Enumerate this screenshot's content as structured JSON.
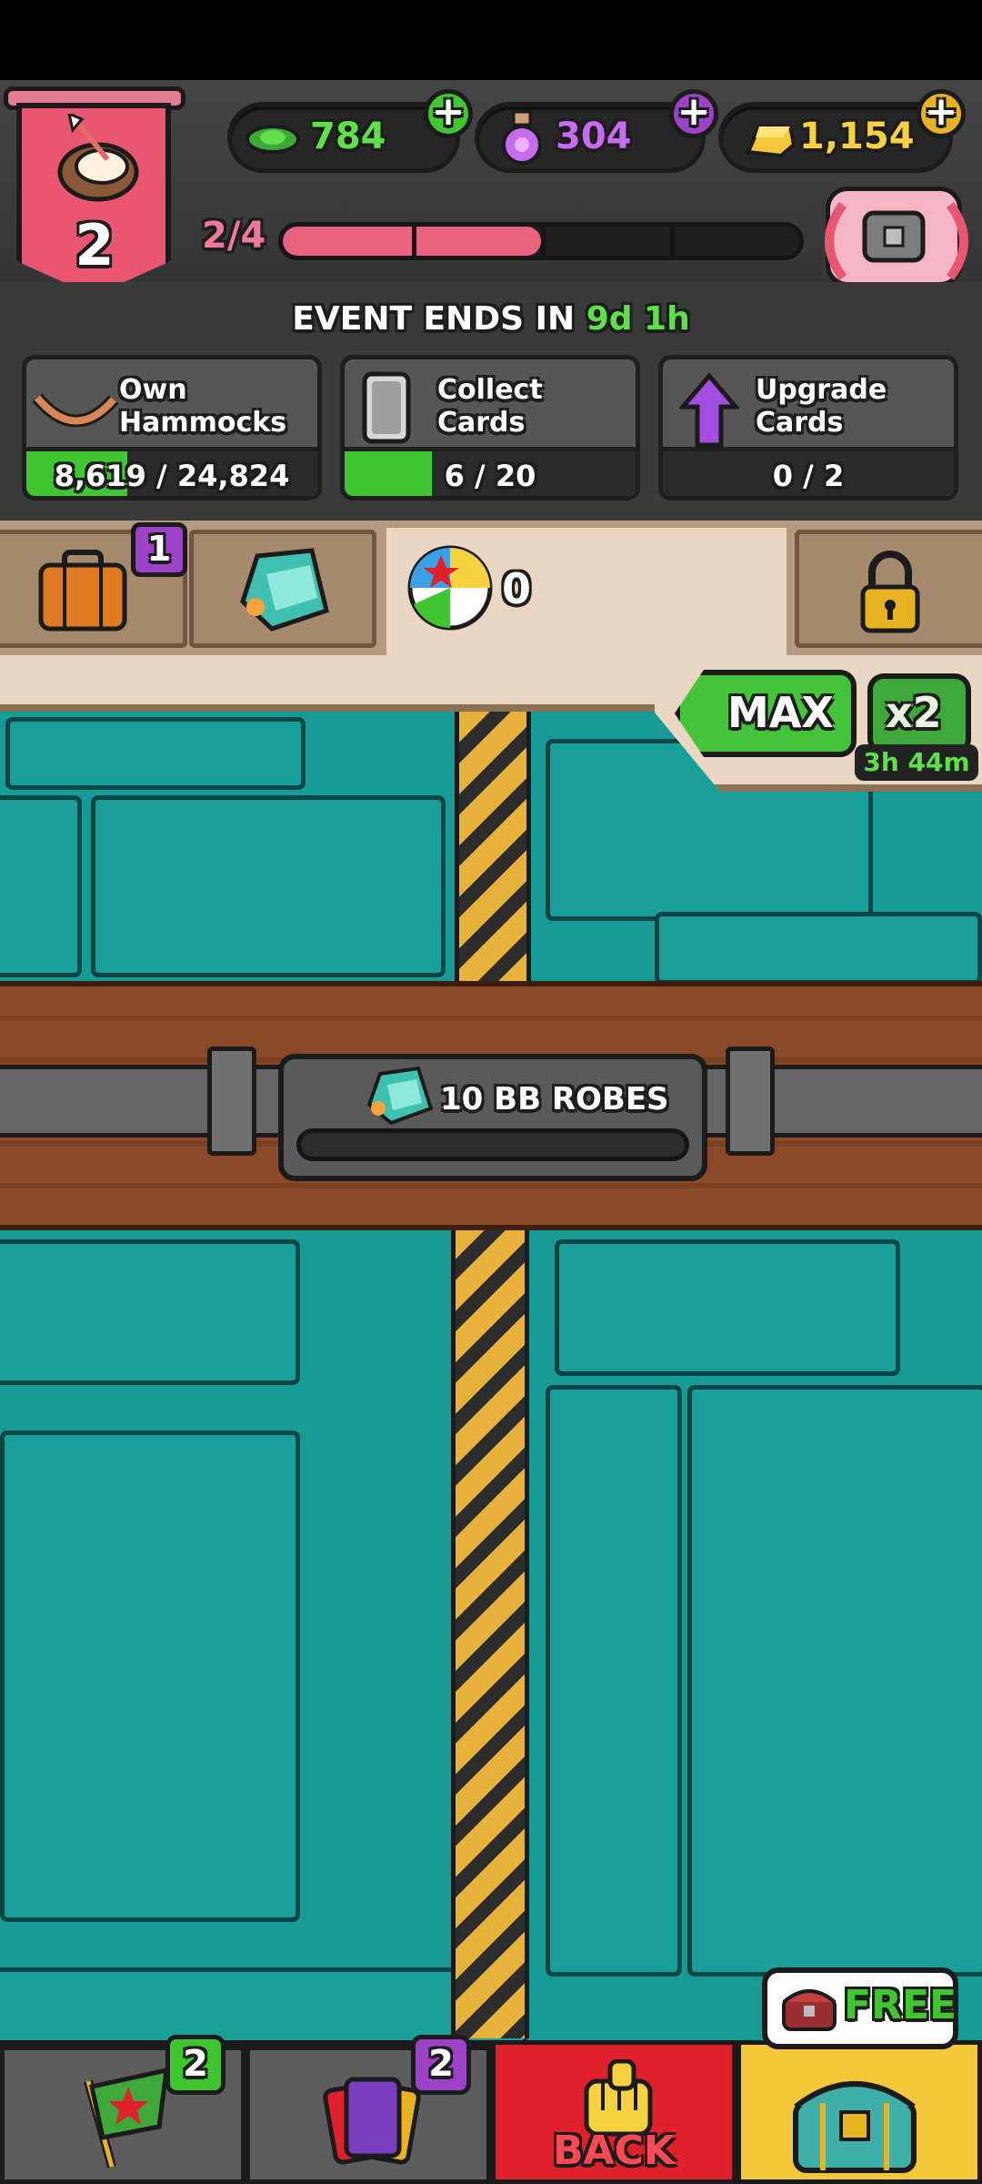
{
  "header": {
    "level": "2",
    "level_progress_text": "2/4",
    "level_progress_fraction": 0.5,
    "currencies": [
      {
        "name": "cash",
        "value": "784",
        "color": "#5fe04a",
        "plus_color": "#3fc630"
      },
      {
        "name": "potions",
        "value": "304",
        "color": "#c76bf0",
        "plus_color": "#9c42c7"
      },
      {
        "name": "gold",
        "value": "1,154",
        "color": "#f7d23f",
        "plus_color": "#e8b320"
      }
    ]
  },
  "event": {
    "timer_prefix": "EVENT ENDS IN",
    "timer_value": "9d 1h",
    "tasks": [
      {
        "label_line1": "Own",
        "label_line2": "Hammocks",
        "progress": "8,619 / 24,824",
        "fraction": 0.347
      },
      {
        "label_line1": "Collect Cards",
        "label_line2": "",
        "progress": "6 / 20",
        "fraction": 0.3
      },
      {
        "label_line1": "Upgrade",
        "label_line2": "Cards",
        "progress": "0 / 2",
        "fraction": 0.0
      }
    ]
  },
  "tabs": {
    "suitcase_badge": "1",
    "ball_count": "0"
  },
  "boost": {
    "max_label": "MAX",
    "x2_label": "x2",
    "x2_timer": "3h 44m"
  },
  "milestone": {
    "label": "10 BB ROBES",
    "fraction": 0.0
  },
  "bottom_nav": {
    "flag_badge": "2",
    "cards_badge": "2",
    "back_label": "BACK",
    "free_label": "FREE"
  }
}
